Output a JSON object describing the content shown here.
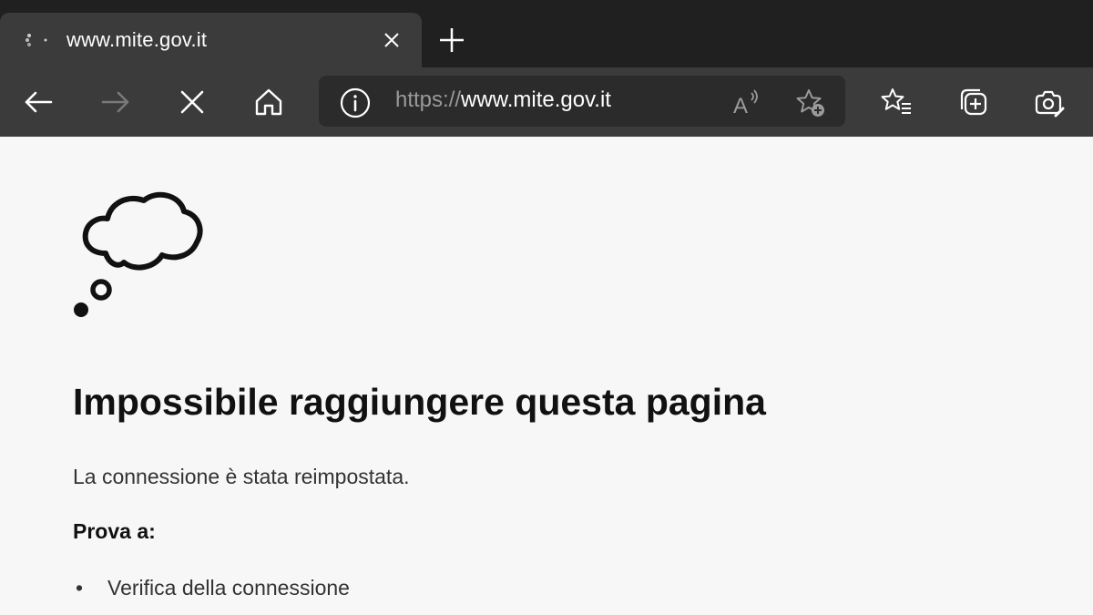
{
  "browser": {
    "tab": {
      "title": "www.mite.gov.it",
      "favicon": "loading-spinner-icon",
      "close_icon": "close-icon"
    },
    "new_tab_icon": "plus-icon",
    "toolbar": {
      "back_icon": "back-arrow-icon",
      "forward_icon": "forward-arrow-icon",
      "stop_icon": "stop-icon",
      "home_icon": "home-icon",
      "site_info_icon": "info-icon",
      "read_aloud_icon": "read-aloud-icon",
      "add_favorite_icon": "add-favorite-icon",
      "favorites_icon": "favorites-icon",
      "collections_icon": "collections-icon",
      "web_capture_icon": "web-capture-icon"
    },
    "address_bar": {
      "scheme": "https://",
      "host": "www.mite.gov.it"
    }
  },
  "error_page": {
    "illustration": "thought-cloud-icon",
    "title": "Impossibile raggiungere questa pagina",
    "message": "La connessione è stata reimpostata.",
    "try_label": "Prova a:",
    "bullet": "•",
    "suggestions": [
      "Verifica della connessione"
    ]
  },
  "colors": {
    "tab_strip": "#202020",
    "toolbar": "#3b3b3b",
    "address_bar": "#2b2b2b",
    "page_background": "#f7f7f7"
  }
}
